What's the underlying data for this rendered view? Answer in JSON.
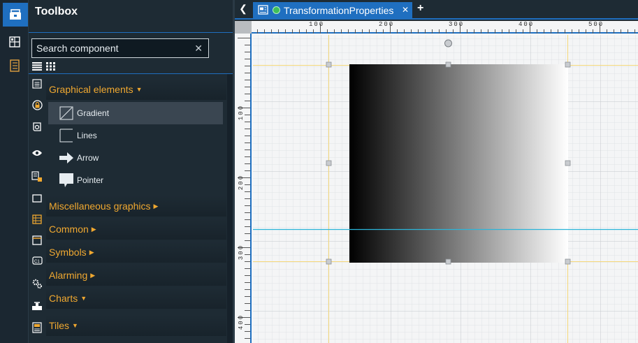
{
  "toolbox": {
    "title": "Toolbox",
    "search_placeholder": "Search component",
    "sections": [
      {
        "label": "Graphical elements",
        "expanded": true
      },
      {
        "label": "Miscellaneous graphics",
        "expanded": false
      },
      {
        "label": "Common",
        "expanded": false
      },
      {
        "label": "Symbols",
        "expanded": false
      },
      {
        "label": "Alarming",
        "expanded": false
      },
      {
        "label": "Charts",
        "expanded": true
      },
      {
        "label": "Tiles",
        "expanded": true
      }
    ],
    "items": [
      {
        "label": "Gradient",
        "icon": "gradient-icon",
        "selected": true
      },
      {
        "label": "Lines",
        "icon": "lines-icon"
      },
      {
        "label": "Arrow",
        "icon": "arrow-icon"
      },
      {
        "label": "Pointer",
        "icon": "pointer-icon"
      }
    ]
  },
  "tabs": {
    "active_label": "TransformationProperties",
    "status_color": "#3fbf5a"
  },
  "ruler": {
    "top_labels": [
      "100",
      "200",
      "300",
      "400",
      "500"
    ],
    "left_labels": [
      "100",
      "200",
      "300",
      "400"
    ]
  },
  "colors": {
    "accent": "#1f6fc0",
    "section_label": "#f0a830",
    "guide_yellow": "#f5d87a",
    "guide_cyan": "#2bb5d9"
  }
}
